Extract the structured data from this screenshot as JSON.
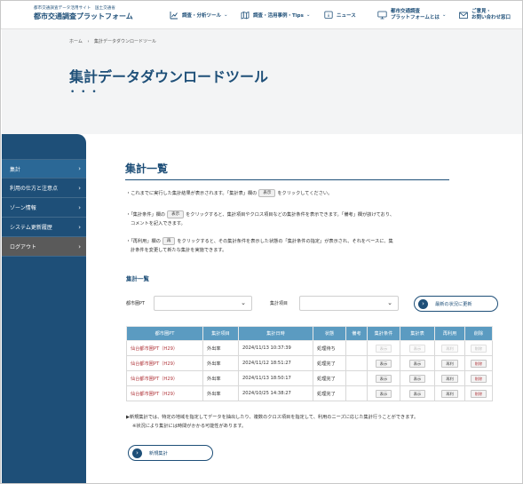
{
  "header": {
    "logo_small": "都市交通調査データ活用サイト　国土交通省",
    "logo_big": "都市交通調査プラットフォーム",
    "nav": [
      {
        "label": "調査・分析ツール",
        "icon": "chart-icon"
      },
      {
        "label": "調査・活用事例・Tips",
        "icon": "map-icon"
      },
      {
        "label": "ニュース",
        "icon": "info-icon"
      },
      {
        "label_1": "都市交通調査",
        "label_2": "プラットフォームとは",
        "icon": "monitor-icon"
      },
      {
        "label_1": "ご意見・",
        "label_2": "お問い合わせ窓口",
        "icon": "mail-icon"
      }
    ]
  },
  "breadcrumb": {
    "home": "ホーム",
    "sep": "›",
    "current": "集計データダウンロードツール"
  },
  "hero": {
    "title": "集計データダウンロードツール",
    "dots": "• • •"
  },
  "sidebar": {
    "items": [
      {
        "label": "集計",
        "arrow": "›"
      },
      {
        "label": "利用の仕方と注意点",
        "arrow": "›"
      },
      {
        "label": "ゾーン情報",
        "arrow": "›"
      },
      {
        "label": "システム更新履歴",
        "arrow": "›"
      },
      {
        "label": "ログアウト",
        "arrow": "›"
      }
    ]
  },
  "main": {
    "title": "集計一覧",
    "notes": {
      "n1_a": "・これまでに実行した集計結果が表示されます。「集計表」欄の",
      "n1_btn": "表示",
      "n1_b": "をクリックしてください。",
      "n2_a": "・「集計条件」欄の",
      "n2_btn": "表示",
      "n2_b": "をクリックすると、集計項目やクロス項目などの集計条件を表示できます。「備考」欄が該けており、",
      "n2_c": "コメントを記入できます。",
      "n3_a": "・「再利用」欄の",
      "n3_btn": "再",
      "n3_b": "をクリックすると、その集計条件を表示した状態の「集計条件の指定」が表示され、それをベースに、集",
      "n3_c": "計条件を変更して新たな集計を実施できます。"
    },
    "sub_title": "集計一覧",
    "filters": {
      "city_label": "都市圏PT",
      "item_label": "集計項目",
      "refresh_label": "最新の状況に更新",
      "arrow": "›",
      "caret": "⌄"
    },
    "table": {
      "headers": [
        "都市圏PT",
        "集計項目",
        "集計日時",
        "状態",
        "備考",
        "集計条件",
        "集計表",
        "再利用",
        "削除"
      ],
      "rows": [
        {
          "city": "仙台都市圏PT（H29）",
          "item": "外出率",
          "date": "2024/11/13 10:37:39",
          "status": "処理待ち",
          "cond": "表示",
          "table": "表示",
          "reuse": "再利",
          "del": "削除",
          "disabled": true
        },
        {
          "city": "仙台都市圏PT（H29）",
          "item": "外出率",
          "date": "2024/11/12 18:51:27",
          "status": "処理完了",
          "cond": "表示",
          "table": "表示",
          "reuse": "再利",
          "del": "削除",
          "disabled": false
        },
        {
          "city": "仙台都市圏PT（H29）",
          "item": "外出率",
          "date": "2024/11/13 18:50:17",
          "status": "処理完了",
          "cond": "表示",
          "table": "表示",
          "reuse": "再利",
          "del": "削除",
          "disabled": false
        },
        {
          "city": "仙台都市圏PT（H29）",
          "item": "外出率",
          "date": "2024/10/25 14:38:27",
          "status": "処理完了",
          "cond": "表示",
          "table": "表示",
          "reuse": "再利",
          "del": "削除",
          "disabled": false
        }
      ]
    },
    "footnote_1": "▶新規集計では、特定の地域を指定してデータを抽出したり、複数のクロス項目を指定して、利用のニーズに応じた集計行うことができます。",
    "footnote_2": "※状況により集計には時間がかかる可能性があります。",
    "new_button": "新規集計"
  },
  "colors": {
    "brand": "#1e4f78",
    "table_header": "#5b9bc1",
    "link": "#b0363b"
  }
}
